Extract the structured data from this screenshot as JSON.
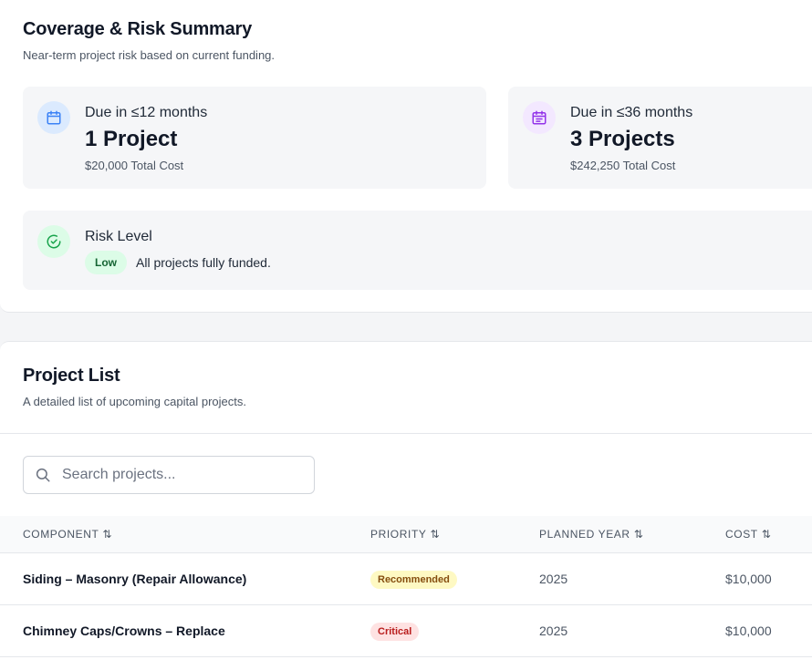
{
  "coverage": {
    "title": "Coverage & Risk Summary",
    "subtitle": "Near-term project risk based on current funding.",
    "due12": {
      "label": "Due in ≤12 months",
      "count": "1 Project",
      "cost": "$20,000 Total Cost",
      "icon": "calendar-icon"
    },
    "due36": {
      "label": "Due in ≤36 months",
      "count": "3 Projects",
      "cost": "$242,250 Total Cost",
      "icon": "calendar-list-icon"
    },
    "risk": {
      "label": "Risk Level",
      "badge": "Low",
      "text": "All projects fully funded.",
      "icon": "check-circle-icon"
    }
  },
  "projects": {
    "title": "Project List",
    "subtitle": "A detailed list of upcoming capital projects.",
    "search_placeholder": "Search projects...",
    "columns": [
      "COMPONENT",
      "PRIORITY",
      "PLANNED YEAR",
      "COST"
    ],
    "rows": [
      {
        "component": "Siding – Masonry (Repair Allowance)",
        "priority": "Recommended",
        "year": "2025",
        "cost": "$10,000"
      },
      {
        "component": "Chimney Caps/Crowns – Replace",
        "priority": "Critical",
        "year": "2025",
        "cost": "$10,000"
      }
    ]
  },
  "colors": {
    "blue_icon": "#3b82f6",
    "purple_icon": "#9333ea",
    "green_icon": "#16a34a",
    "recommended_bg": "#fef9c3",
    "recommended_fg": "#854d0e",
    "critical_bg": "#fee2e2",
    "critical_fg": "#b91c1c"
  }
}
